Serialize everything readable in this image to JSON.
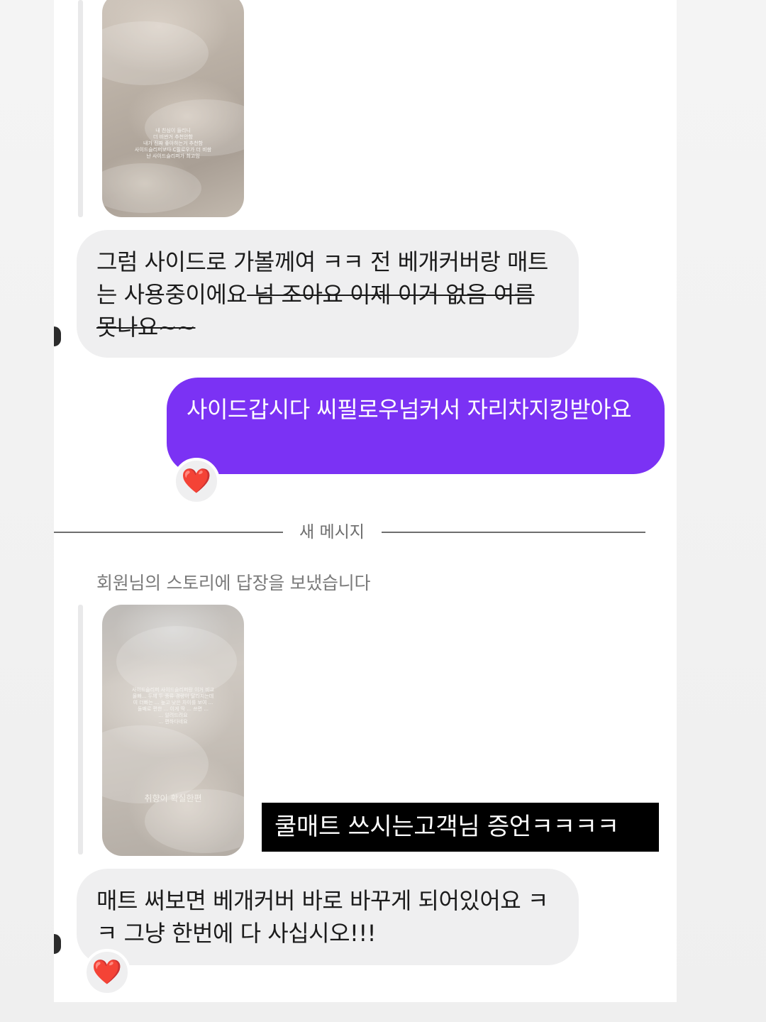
{
  "thread": {
    "story_1": {
      "caption_lines": [
        "내 친심이 들리니",
        "더 비싼거 추천안함",
        "내가 진짜 좋아하는거 추천함",
        "사이드슬리퍼보다 C필로우가 더 비쌈",
        "난 사이드슬리퍼가 최고임"
      ]
    },
    "message_1": {
      "text_plain": "그럼 사이드로 가볼께여 ㅋㅋ 전 베개커버랑 매트는 사용중이에요",
      "text_struck": " 넘 조아요 이제 이거 없음 여름 못나요~~"
    },
    "message_2": {
      "text": "사이드갑시다 씨필로우넘커서 자리차지킹받아요",
      "reaction": "❤️"
    },
    "divider": {
      "label": "새 메시지"
    },
    "story_reply_note": "회원님의 스토리에 답장을 보냈습니다",
    "story_2": {
      "caption_lines": [
        "사이드슬리퍼 사이드슬리퍼랑 이거 비교",
        "물빠... 두께 두 종류 경량이 달라지는데",
        "여 더빠는 ... 높고 낮은 차이를 보여 ...",
        "둘째로 편한 ... 이게 딱 ... 쓰면 ...",
        "... 알려드려요",
        "... 편하다네요"
      ],
      "label": "취향이 확실한편"
    },
    "overlay_caption": "쿨매트 쓰시는고객님 증언ㅋㅋㅋㅋ",
    "message_3": {
      "text": "매트 써보면 베개커버 바로 바꾸게 되어있어요 ㅋㅋ 그냥 한번에 다 사십시오!!!",
      "reaction": "❤️"
    }
  },
  "colors": {
    "outgoing_bubble": "#7b32f4",
    "incoming_bubble": "#efeff0",
    "reaction_heart": "#e01e2f"
  }
}
